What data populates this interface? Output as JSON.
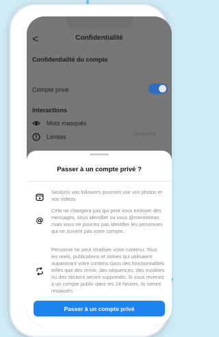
{
  "nav": {
    "title": "Confidentialité",
    "back_glyph": "<"
  },
  "section_account": "Confidentialité du compte",
  "private_row": {
    "label": "Compte privé",
    "enabled": true
  },
  "section_interactions": "Interactions",
  "rows": [
    {
      "label": "Mots masqués",
      "icon": "eye-slash-icon"
    },
    {
      "label": "Limites",
      "value": "Désactivé",
      "icon": "alert-icon"
    }
  ],
  "sheet": {
    "title": "Passer à un compte privé ?",
    "items": [
      {
        "icon": "photo-frame-icon",
        "text": "Seul(e)s vos followers pourront voir vos photos et vos vidéos."
      },
      {
        "icon": "mention-at-icon",
        "text": "Cela ne changera pas qui peut vous envoyer des messages, vous identifier ou vous @mentionner, mais vous ne pourrez pas identifier les personnes qui ne suivent pas votre compte."
      },
      {
        "icon": "remix-icon",
        "text": "Personne ne peut réutiliser votre contenu. Tous les reels, publications et stories qui utilisaient auparavant votre contenu dans des fonctionnalités telles que des remix, des séquences, des modèles ou des stickers seront supprimés. Si vous revenez à un compte public dans les 24 heures, ils seront restaurés."
      }
    ],
    "button_label": "Passer à un compte privé"
  },
  "colors": {
    "accent": "#1e83ee",
    "toggle": "#2f6cc7",
    "background": "#cfe9f5"
  }
}
